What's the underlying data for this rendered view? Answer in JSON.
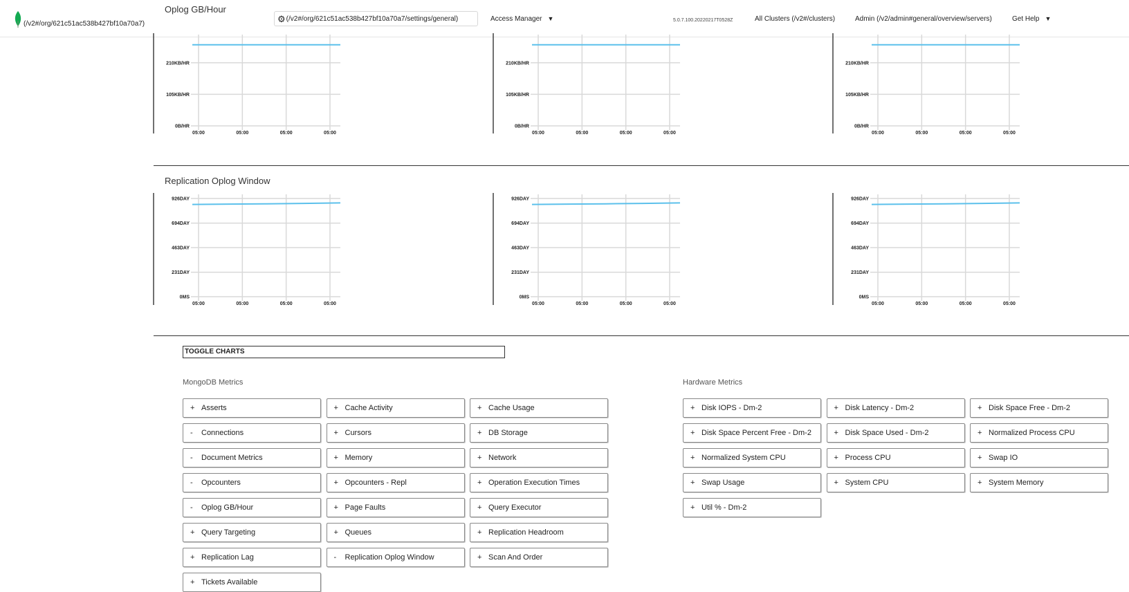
{
  "header": {
    "org_link": "(/v2#/org/621c51ac538b427bf10a70a7)",
    "settings_link": "(/v2#/org/621c51ac538b427bf10a70a7/settings/general)",
    "access_manager": "Access Manager",
    "version": "5.0.7.100.20220217T0528Z",
    "all_clusters": "All Clusters (/v2#/clusters)",
    "admin": "Admin (/v2/admin#general/overview/servers)",
    "get_help": "Get Help"
  },
  "sections": {
    "oplog_title": "Oplog GB/Hour",
    "replication_title": "Replication Oplog Window"
  },
  "colors": {
    "series": "#5bc0eb",
    "grid": "#d9d9d9"
  },
  "chart_data": [
    {
      "type": "line",
      "title": "Oplog GB/Hour",
      "y_ticks": [
        "0B/HR",
        "105KB/HR",
        "210KB/HR"
      ],
      "ylim": [
        0,
        290
      ],
      "x_ticks": [
        "05:00",
        "05:00",
        "05:00",
        "05:00"
      ],
      "series": [
        {
          "values": [
            270,
            270,
            270,
            270,
            270
          ]
        }
      ],
      "grid": true
    },
    {
      "type": "line",
      "title": "Oplog GB/Hour",
      "y_ticks": [
        "0B/HR",
        "105KB/HR",
        "210KB/HR"
      ],
      "ylim": [
        0,
        290
      ],
      "x_ticks": [
        "05:00",
        "05:00",
        "05:00",
        "05:00"
      ],
      "series": [
        {
          "values": [
            270,
            270,
            270,
            270,
            270
          ]
        }
      ],
      "grid": true
    },
    {
      "type": "line",
      "title": "Oplog GB/Hour",
      "y_ticks": [
        "0B/HR",
        "105KB/HR",
        "210KB/HR"
      ],
      "ylim": [
        0,
        290
      ],
      "x_ticks": [
        "05:00",
        "05:00",
        "05:00",
        "05:00"
      ],
      "series": [
        {
          "values": [
            270,
            270,
            270,
            270,
            270
          ]
        }
      ],
      "grid": true
    },
    {
      "type": "line",
      "title": "Replication Oplog Window",
      "y_ticks": [
        "0MS",
        "231DAY",
        "463DAY",
        "694DAY",
        "926DAY"
      ],
      "ylim": [
        0,
        926
      ],
      "x_ticks": [
        "05:00",
        "05:00",
        "05:00",
        "05:00"
      ],
      "series": [
        {
          "values": [
            870,
            873,
            876,
            880,
            884
          ]
        }
      ],
      "grid": true
    },
    {
      "type": "line",
      "title": "Replication Oplog Window",
      "y_ticks": [
        "0MS",
        "231DAY",
        "463DAY",
        "694DAY",
        "926DAY"
      ],
      "ylim": [
        0,
        926
      ],
      "x_ticks": [
        "05:00",
        "05:00",
        "05:00",
        "05:00"
      ],
      "series": [
        {
          "values": [
            870,
            873,
            876,
            880,
            884
          ]
        }
      ],
      "grid": true
    },
    {
      "type": "line",
      "title": "Replication Oplog Window",
      "y_ticks": [
        "0MS",
        "231DAY",
        "463DAY",
        "694DAY",
        "926DAY"
      ],
      "ylim": [
        0,
        926
      ],
      "x_ticks": [
        "05:00",
        "05:00",
        "05:00",
        "05:00"
      ],
      "series": [
        {
          "values": [
            870,
            873,
            876,
            880,
            884
          ]
        }
      ],
      "grid": true
    }
  ],
  "toggle_charts": "TOGGLE CHARTS",
  "mongodb_metrics": {
    "label": "MongoDB Metrics",
    "items": [
      {
        "sign": "+",
        "label": "Asserts"
      },
      {
        "sign": "+",
        "label": "Cache Activity"
      },
      {
        "sign": "+",
        "label": "Cache Usage"
      },
      {
        "sign": "-",
        "label": "Connections"
      },
      {
        "sign": "+",
        "label": "Cursors"
      },
      {
        "sign": "+",
        "label": "DB Storage"
      },
      {
        "sign": "-",
        "label": "Document Metrics"
      },
      {
        "sign": "+",
        "label": "Memory"
      },
      {
        "sign": "+",
        "label": "Network"
      },
      {
        "sign": "-",
        "label": "Opcounters"
      },
      {
        "sign": "+",
        "label": "Opcounters - Repl"
      },
      {
        "sign": "+",
        "label": "Operation Execution Times"
      },
      {
        "sign": "-",
        "label": "Oplog GB/Hour"
      },
      {
        "sign": "+",
        "label": "Page Faults"
      },
      {
        "sign": "+",
        "label": "Query Executor"
      },
      {
        "sign": "+",
        "label": "Query Targeting"
      },
      {
        "sign": "+",
        "label": "Queues"
      },
      {
        "sign": "+",
        "label": "Replication Headroom"
      },
      {
        "sign": "+",
        "label": "Replication Lag"
      },
      {
        "sign": "-",
        "label": "Replication Oplog Window"
      },
      {
        "sign": "+",
        "label": "Scan And Order"
      },
      {
        "sign": "+",
        "label": "Tickets Available"
      }
    ]
  },
  "hardware_metrics": {
    "label": "Hardware Metrics",
    "items": [
      {
        "sign": "+",
        "label": "Disk IOPS - Dm-2"
      },
      {
        "sign": "+",
        "label": "Disk Latency - Dm-2"
      },
      {
        "sign": "+",
        "label": "Disk Space Free - Dm-2"
      },
      {
        "sign": "+",
        "label": "Disk Space Percent Free - Dm-2"
      },
      {
        "sign": "+",
        "label": "Disk Space Used - Dm-2"
      },
      {
        "sign": "+",
        "label": "Normalized Process CPU"
      },
      {
        "sign": "+",
        "label": "Normalized System CPU"
      },
      {
        "sign": "+",
        "label": "Process CPU"
      },
      {
        "sign": "+",
        "label": "Swap IO"
      },
      {
        "sign": "+",
        "label": "Swap Usage"
      },
      {
        "sign": "+",
        "label": "System CPU"
      },
      {
        "sign": "+",
        "label": "System Memory"
      },
      {
        "sign": "+",
        "label": "Util % - Dm-2"
      }
    ]
  }
}
